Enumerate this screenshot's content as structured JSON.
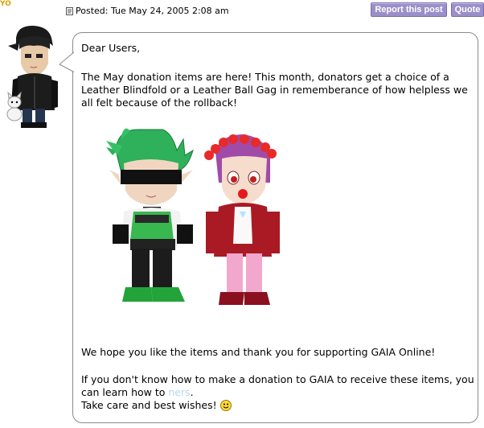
{
  "post": {
    "username": "YO",
    "posted_label": "Posted: Tue May 24, 2005 2:08 am",
    "buttons": {
      "report": "Report this post",
      "quote": "Quote"
    }
  },
  "message": {
    "greeting": "Dear Users,",
    "paragraph1": "The May donation items are here! This month, donators get a choice of a Leather Blindfold or a Leather Ball Gag in rememberance of how helpless we all felt because of the rollback!",
    "paragraph2": "We hope you like the items and thank you for supporting GAIA Online!",
    "paragraph3_line1": "If you don't know how to make a donation to GAIA to receive these items, you can learn how to ",
    "paragraph3_link": "ners",
    "paragraph3_after_link": ".",
    "closing": "Take care and best wishes!"
  },
  "icons": {
    "post_icon": "document-icon",
    "smiley": "smiley-icon",
    "avatar": "user-avatar",
    "donation_art": "donation-items-illustration"
  },
  "colors": {
    "button_bg": "#9a8fc8",
    "username": "#d8a000",
    "link": "#b7d8ee",
    "bubble_border": "#8a8a8a"
  }
}
